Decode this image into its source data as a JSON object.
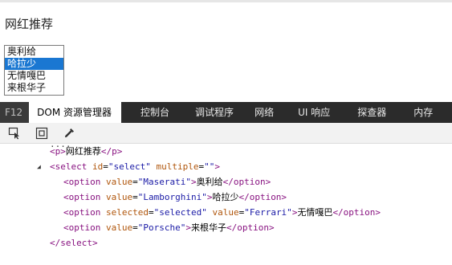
{
  "page": {
    "heading": "网红推荐",
    "listbox": [
      {
        "label": "奥利给",
        "selected": false
      },
      {
        "label": "哈拉少",
        "selected": true
      },
      {
        "label": "无情嘎巴",
        "selected": false
      },
      {
        "label": "来根华子",
        "selected": false
      }
    ]
  },
  "devtools": {
    "tabs": [
      "F12",
      "DOM 资源管理器",
      "控制台",
      "调试程序",
      "网络",
      "UI 响应",
      "探查器",
      "内存"
    ],
    "active_tab": "DOM 资源管理器",
    "toolbar_icons": [
      "select-element-icon",
      "highlight-box-icon",
      "color-picker-icon"
    ],
    "dom": {
      "cut_text": "....",
      "p_open": "<p>",
      "p_text": "网红推荐",
      "p_close": "</p>",
      "select_open": "<select",
      "select_id_attr": "id",
      "select_id_val": "\"select\"",
      "select_multiple_attr": "multiple",
      "select_multiple_val": "\"\"",
      "select_gt": ">",
      "select_close": "</select>",
      "options": [
        {
          "selected_attr": "",
          "value": "\"Maserati\"",
          "text": "奥利给"
        },
        {
          "selected_attr": "",
          "value": "\"Lamborghini\"",
          "text": "哈拉少"
        },
        {
          "selected_attr": "selected=\"selected\"",
          "value": "\"Ferrari\"",
          "text": "无情嘎巴"
        },
        {
          "selected_attr": "",
          "value": "\"Porsche\"",
          "text": "来根华子"
        }
      ],
      "option_open": "<option",
      "option_close": "</option>",
      "value_attr": "value",
      "selected_attr_name": "selected",
      "selected_attr_val": "\"selected\"",
      "collapse_glyph": "◢"
    }
  }
}
